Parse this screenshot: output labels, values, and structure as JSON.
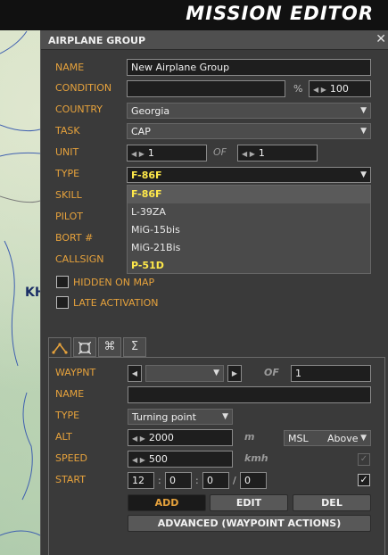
{
  "window_title": "MISSION EDITOR",
  "map": {
    "label": "KH"
  },
  "panel": {
    "title": "AIRPLANE GROUP",
    "close_icon": "✕",
    "name": {
      "label": "NAME",
      "value": "New Airplane Group"
    },
    "condition": {
      "label": "CONDITION",
      "value": "",
      "percent_sign": "%",
      "probability": "100"
    },
    "country": {
      "label": "COUNTRY",
      "value": "Georgia"
    },
    "task": {
      "label": "TASK",
      "value": "CAP"
    },
    "unit": {
      "label": "UNIT",
      "value": "1",
      "of_label": "OF",
      "total": "1"
    },
    "type": {
      "label": "TYPE",
      "value": "F-86F",
      "options": [
        "F-86F",
        "L-39ZA",
        "MiG-15bis",
        "MiG-21Bis",
        "P-51D"
      ]
    },
    "skill": {
      "label": "SKILL"
    },
    "pilot": {
      "label": "PILOT"
    },
    "bort": {
      "label": "BORT #"
    },
    "callsign": {
      "label": "CALLSIGN"
    },
    "hidden_on_map": {
      "label": "HIDDEN ON MAP",
      "checked": false
    },
    "late_activation": {
      "label": "LATE ACTIVATION",
      "checked": false
    },
    "tabs": [
      {
        "name": "route-tab",
        "icon": "route-icon",
        "active": true
      },
      {
        "name": "targets-tab",
        "icon": "target-icon",
        "active": false
      },
      {
        "name": "actions-tab",
        "icon": "command-icon",
        "active": false
      },
      {
        "name": "summary-tab",
        "icon": "sigma-icon",
        "active": false
      }
    ],
    "waypoint": {
      "label": "WAYPNT",
      "value": "",
      "of_label": "OF",
      "total": "1",
      "name_label": "NAME",
      "name_value": "",
      "type_label": "TYPE",
      "type_value": "Turning point",
      "alt_label": "ALT",
      "alt_value": "2000",
      "alt_unit": "m",
      "alt_ref": "MSL",
      "alt_mode": "Above",
      "speed_label": "SPEED",
      "speed_value": "500",
      "speed_unit": "kmh",
      "start_label": "START",
      "start_hh": "12",
      "start_mm": "0",
      "start_ss": "0",
      "start_day": "0",
      "time_sep": ":",
      "day_sep": "/",
      "add_label": "ADD",
      "edit_label": "EDIT",
      "del_label": "DEL",
      "advanced_label": "ADVANCED (WAYPOINT ACTIONS)"
    }
  },
  "colors": {
    "accent": "#e6a23c",
    "highlight": "#ffe94a",
    "panel": "#3a3a3a"
  }
}
